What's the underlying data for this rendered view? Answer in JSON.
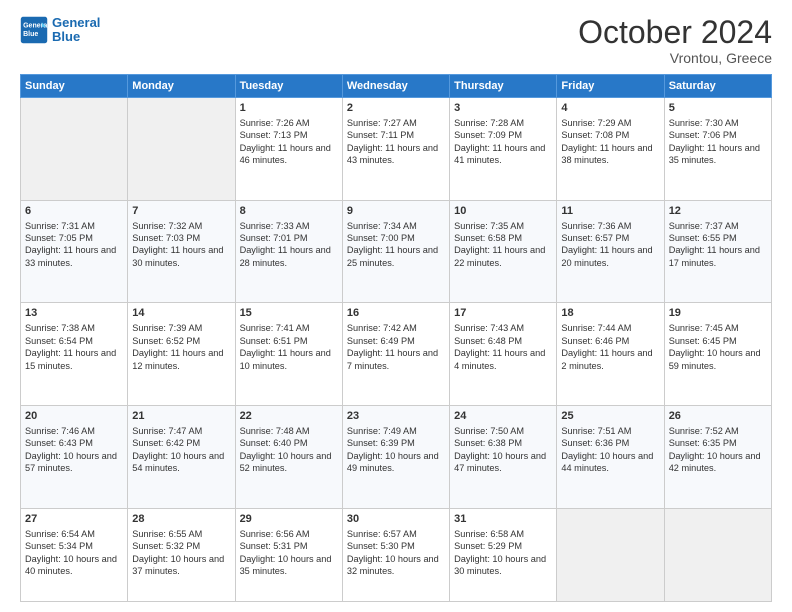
{
  "header": {
    "logo_line1": "General",
    "logo_line2": "Blue",
    "month_title": "October 2024",
    "subtitle": "Vrontou, Greece"
  },
  "weekdays": [
    "Sunday",
    "Monday",
    "Tuesday",
    "Wednesday",
    "Thursday",
    "Friday",
    "Saturday"
  ],
  "weeks": [
    [
      {
        "day": "",
        "sunrise": "",
        "sunset": "",
        "daylight": ""
      },
      {
        "day": "",
        "sunrise": "",
        "sunset": "",
        "daylight": ""
      },
      {
        "day": "1",
        "sunrise": "Sunrise: 7:26 AM",
        "sunset": "Sunset: 7:13 PM",
        "daylight": "Daylight: 11 hours and 46 minutes."
      },
      {
        "day": "2",
        "sunrise": "Sunrise: 7:27 AM",
        "sunset": "Sunset: 7:11 PM",
        "daylight": "Daylight: 11 hours and 43 minutes."
      },
      {
        "day": "3",
        "sunrise": "Sunrise: 7:28 AM",
        "sunset": "Sunset: 7:09 PM",
        "daylight": "Daylight: 11 hours and 41 minutes."
      },
      {
        "day": "4",
        "sunrise": "Sunrise: 7:29 AM",
        "sunset": "Sunset: 7:08 PM",
        "daylight": "Daylight: 11 hours and 38 minutes."
      },
      {
        "day": "5",
        "sunrise": "Sunrise: 7:30 AM",
        "sunset": "Sunset: 7:06 PM",
        "daylight": "Daylight: 11 hours and 35 minutes."
      }
    ],
    [
      {
        "day": "6",
        "sunrise": "Sunrise: 7:31 AM",
        "sunset": "Sunset: 7:05 PM",
        "daylight": "Daylight: 11 hours and 33 minutes."
      },
      {
        "day": "7",
        "sunrise": "Sunrise: 7:32 AM",
        "sunset": "Sunset: 7:03 PM",
        "daylight": "Daylight: 11 hours and 30 minutes."
      },
      {
        "day": "8",
        "sunrise": "Sunrise: 7:33 AM",
        "sunset": "Sunset: 7:01 PM",
        "daylight": "Daylight: 11 hours and 28 minutes."
      },
      {
        "day": "9",
        "sunrise": "Sunrise: 7:34 AM",
        "sunset": "Sunset: 7:00 PM",
        "daylight": "Daylight: 11 hours and 25 minutes."
      },
      {
        "day": "10",
        "sunrise": "Sunrise: 7:35 AM",
        "sunset": "Sunset: 6:58 PM",
        "daylight": "Daylight: 11 hours and 22 minutes."
      },
      {
        "day": "11",
        "sunrise": "Sunrise: 7:36 AM",
        "sunset": "Sunset: 6:57 PM",
        "daylight": "Daylight: 11 hours and 20 minutes."
      },
      {
        "day": "12",
        "sunrise": "Sunrise: 7:37 AM",
        "sunset": "Sunset: 6:55 PM",
        "daylight": "Daylight: 11 hours and 17 minutes."
      }
    ],
    [
      {
        "day": "13",
        "sunrise": "Sunrise: 7:38 AM",
        "sunset": "Sunset: 6:54 PM",
        "daylight": "Daylight: 11 hours and 15 minutes."
      },
      {
        "day": "14",
        "sunrise": "Sunrise: 7:39 AM",
        "sunset": "Sunset: 6:52 PM",
        "daylight": "Daylight: 11 hours and 12 minutes."
      },
      {
        "day": "15",
        "sunrise": "Sunrise: 7:41 AM",
        "sunset": "Sunset: 6:51 PM",
        "daylight": "Daylight: 11 hours and 10 minutes."
      },
      {
        "day": "16",
        "sunrise": "Sunrise: 7:42 AM",
        "sunset": "Sunset: 6:49 PM",
        "daylight": "Daylight: 11 hours and 7 minutes."
      },
      {
        "day": "17",
        "sunrise": "Sunrise: 7:43 AM",
        "sunset": "Sunset: 6:48 PM",
        "daylight": "Daylight: 11 hours and 4 minutes."
      },
      {
        "day": "18",
        "sunrise": "Sunrise: 7:44 AM",
        "sunset": "Sunset: 6:46 PM",
        "daylight": "Daylight: 11 hours and 2 minutes."
      },
      {
        "day": "19",
        "sunrise": "Sunrise: 7:45 AM",
        "sunset": "Sunset: 6:45 PM",
        "daylight": "Daylight: 10 hours and 59 minutes."
      }
    ],
    [
      {
        "day": "20",
        "sunrise": "Sunrise: 7:46 AM",
        "sunset": "Sunset: 6:43 PM",
        "daylight": "Daylight: 10 hours and 57 minutes."
      },
      {
        "day": "21",
        "sunrise": "Sunrise: 7:47 AM",
        "sunset": "Sunset: 6:42 PM",
        "daylight": "Daylight: 10 hours and 54 minutes."
      },
      {
        "day": "22",
        "sunrise": "Sunrise: 7:48 AM",
        "sunset": "Sunset: 6:40 PM",
        "daylight": "Daylight: 10 hours and 52 minutes."
      },
      {
        "day": "23",
        "sunrise": "Sunrise: 7:49 AM",
        "sunset": "Sunset: 6:39 PM",
        "daylight": "Daylight: 10 hours and 49 minutes."
      },
      {
        "day": "24",
        "sunrise": "Sunrise: 7:50 AM",
        "sunset": "Sunset: 6:38 PM",
        "daylight": "Daylight: 10 hours and 47 minutes."
      },
      {
        "day": "25",
        "sunrise": "Sunrise: 7:51 AM",
        "sunset": "Sunset: 6:36 PM",
        "daylight": "Daylight: 10 hours and 44 minutes."
      },
      {
        "day": "26",
        "sunrise": "Sunrise: 7:52 AM",
        "sunset": "Sunset: 6:35 PM",
        "daylight": "Daylight: 10 hours and 42 minutes."
      }
    ],
    [
      {
        "day": "27",
        "sunrise": "Sunrise: 6:54 AM",
        "sunset": "Sunset: 5:34 PM",
        "daylight": "Daylight: 10 hours and 40 minutes."
      },
      {
        "day": "28",
        "sunrise": "Sunrise: 6:55 AM",
        "sunset": "Sunset: 5:32 PM",
        "daylight": "Daylight: 10 hours and 37 minutes."
      },
      {
        "day": "29",
        "sunrise": "Sunrise: 6:56 AM",
        "sunset": "Sunset: 5:31 PM",
        "daylight": "Daylight: 10 hours and 35 minutes."
      },
      {
        "day": "30",
        "sunrise": "Sunrise: 6:57 AM",
        "sunset": "Sunset: 5:30 PM",
        "daylight": "Daylight: 10 hours and 32 minutes."
      },
      {
        "day": "31",
        "sunrise": "Sunrise: 6:58 AM",
        "sunset": "Sunset: 5:29 PM",
        "daylight": "Daylight: 10 hours and 30 minutes."
      },
      {
        "day": "",
        "sunrise": "",
        "sunset": "",
        "daylight": ""
      },
      {
        "day": "",
        "sunrise": "",
        "sunset": "",
        "daylight": ""
      }
    ]
  ]
}
